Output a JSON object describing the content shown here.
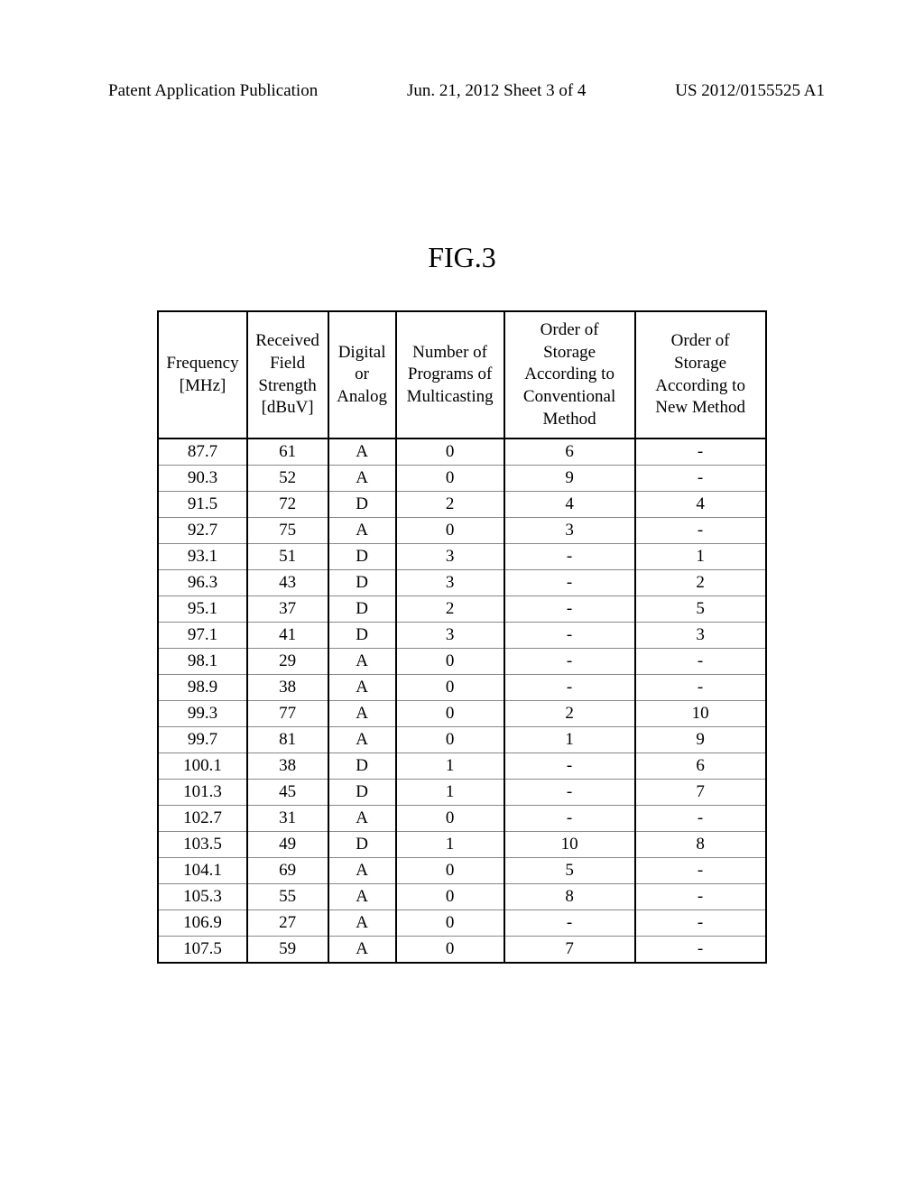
{
  "header": {
    "left": "Patent Application Publication",
    "center": "Jun. 21, 2012  Sheet 3 of 4",
    "right": "US 2012/0155525 A1"
  },
  "figure_label": "FIG.3",
  "chart_data": {
    "type": "table",
    "title": "FIG.3",
    "columns": [
      "Frequency [MHz]",
      "Received Field Strength [dBuV]",
      "Digital or Analog",
      "Number of Programs of Multicasting",
      "Order of Storage According to Conventional Method",
      "Order of Storage According to New Method"
    ],
    "rows": [
      {
        "freq": "87.7",
        "strength": "61",
        "type": "A",
        "programs": "0",
        "conv_order": "6",
        "new_order": "-"
      },
      {
        "freq": "90.3",
        "strength": "52",
        "type": "A",
        "programs": "0",
        "conv_order": "9",
        "new_order": "-"
      },
      {
        "freq": "91.5",
        "strength": "72",
        "type": "D",
        "programs": "2",
        "conv_order": "4",
        "new_order": "4"
      },
      {
        "freq": "92.7",
        "strength": "75",
        "type": "A",
        "programs": "0",
        "conv_order": "3",
        "new_order": "-"
      },
      {
        "freq": "93.1",
        "strength": "51",
        "type": "D",
        "programs": "3",
        "conv_order": "-",
        "new_order": "1"
      },
      {
        "freq": "96.3",
        "strength": "43",
        "type": "D",
        "programs": "3",
        "conv_order": "-",
        "new_order": "2"
      },
      {
        "freq": "95.1",
        "strength": "37",
        "type": "D",
        "programs": "2",
        "conv_order": "-",
        "new_order": "5"
      },
      {
        "freq": "97.1",
        "strength": "41",
        "type": "D",
        "programs": "3",
        "conv_order": "-",
        "new_order": "3"
      },
      {
        "freq": "98.1",
        "strength": "29",
        "type": "A",
        "programs": "0",
        "conv_order": "-",
        "new_order": "-"
      },
      {
        "freq": "98.9",
        "strength": "38",
        "type": "A",
        "programs": "0",
        "conv_order": "-",
        "new_order": "-"
      },
      {
        "freq": "99.3",
        "strength": "77",
        "type": "A",
        "programs": "0",
        "conv_order": "2",
        "new_order": "10"
      },
      {
        "freq": "99.7",
        "strength": "81",
        "type": "A",
        "programs": "0",
        "conv_order": "1",
        "new_order": "9"
      },
      {
        "freq": "100.1",
        "strength": "38",
        "type": "D",
        "programs": "1",
        "conv_order": "-",
        "new_order": "6"
      },
      {
        "freq": "101.3",
        "strength": "45",
        "type": "D",
        "programs": "1",
        "conv_order": "-",
        "new_order": "7"
      },
      {
        "freq": "102.7",
        "strength": "31",
        "type": "A",
        "programs": "0",
        "conv_order": "-",
        "new_order": "-"
      },
      {
        "freq": "103.5",
        "strength": "49",
        "type": "D",
        "programs": "1",
        "conv_order": "10",
        "new_order": "8"
      },
      {
        "freq": "104.1",
        "strength": "69",
        "type": "A",
        "programs": "0",
        "conv_order": "5",
        "new_order": "-"
      },
      {
        "freq": "105.3",
        "strength": "55",
        "type": "A",
        "programs": "0",
        "conv_order": "8",
        "new_order": "-"
      },
      {
        "freq": "106.9",
        "strength": "27",
        "type": "A",
        "programs": "0",
        "conv_order": "-",
        "new_order": "-"
      },
      {
        "freq": "107.5",
        "strength": "59",
        "type": "A",
        "programs": "0",
        "conv_order": "7",
        "new_order": "-"
      }
    ]
  }
}
